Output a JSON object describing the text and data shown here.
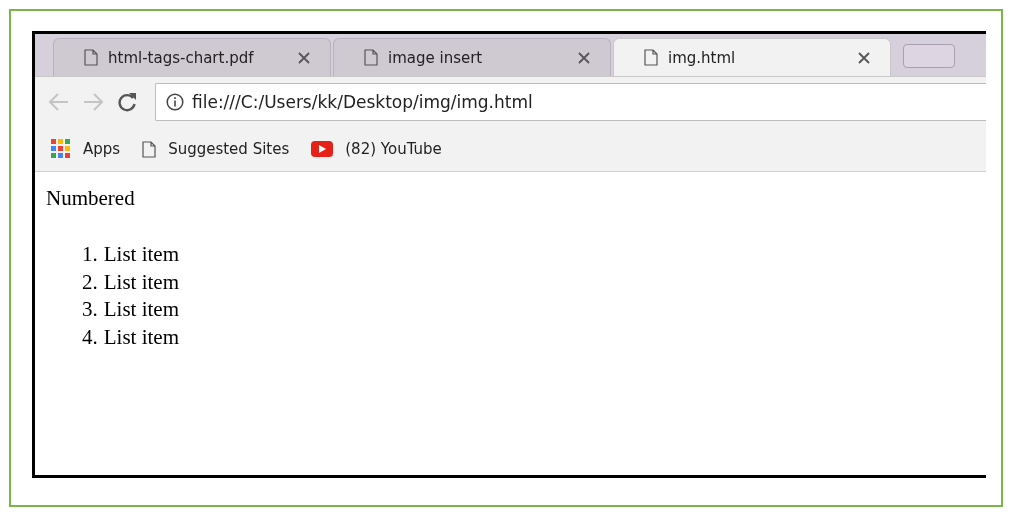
{
  "tabs": [
    {
      "title": "html-tags-chart.pdf",
      "selected": false
    },
    {
      "title": "image insert",
      "selected": false
    },
    {
      "title": "img.html",
      "selected": true
    }
  ],
  "address_bar": {
    "value": "file:///C:/Users/kk/Desktop/img/img.html"
  },
  "bookmarks": [
    {
      "kind": "apps",
      "label": "Apps"
    },
    {
      "kind": "page",
      "label": "Suggested Sites"
    },
    {
      "kind": "video",
      "label": "(82) YouTube"
    }
  ],
  "page": {
    "heading": "Numbered",
    "list": [
      {
        "number": "1.",
        "text": "List item"
      },
      {
        "number": "2.",
        "text": "List item"
      },
      {
        "number": "3.",
        "text": "List item"
      },
      {
        "number": "4.",
        "text": "List item"
      }
    ]
  }
}
